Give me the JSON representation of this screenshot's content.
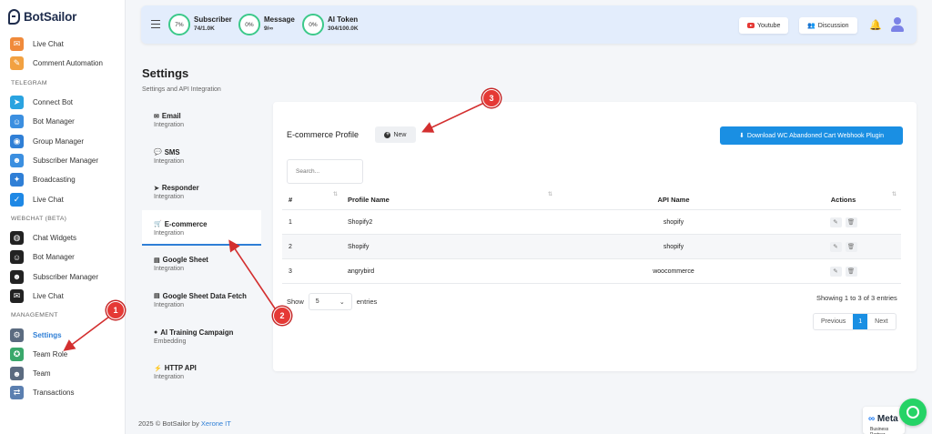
{
  "brand": {
    "name": "BotSailor"
  },
  "sidebar": {
    "items_top": [
      {
        "label": "Live Chat",
        "icon": "chat-bubble-icon",
        "color": "#f08a3b"
      },
      {
        "label": "Comment Automation",
        "icon": "comment-icon",
        "color": "#f2a142"
      }
    ],
    "telegram_heading": "TELEGRAM",
    "telegram": [
      {
        "label": "Connect Bot",
        "icon": "telegram-icon",
        "color": "#2aa3e0"
      },
      {
        "label": "Bot Manager",
        "icon": "robot-icon",
        "color": "#3b8fe0"
      },
      {
        "label": "Group Manager",
        "icon": "group-icon",
        "color": "#2f7fd6"
      },
      {
        "label": "Subscriber Manager",
        "icon": "subscriber-icon",
        "color": "#3b8fe0"
      },
      {
        "label": "Broadcasting",
        "icon": "broadcast-icon",
        "color": "#2f7fd6"
      },
      {
        "label": "Live Chat",
        "icon": "check-bubble-icon",
        "color": "#1e88e5"
      }
    ],
    "webchat_heading": "WEBCHAT (BETA)",
    "webchat": [
      {
        "label": "Chat Widgets",
        "icon": "globe-icon",
        "color": "#222222"
      },
      {
        "label": "Bot Manager",
        "icon": "robot-icon",
        "color": "#222222"
      },
      {
        "label": "Subscriber Manager",
        "icon": "subscriber-icon",
        "color": "#222222"
      },
      {
        "label": "Live Chat",
        "icon": "chat-bubble-icon",
        "color": "#222222"
      }
    ],
    "management_heading": "MANAGEMENT",
    "management": [
      {
        "label": "Settings",
        "icon": "gear-icon",
        "color": "#5b6b80",
        "active": true
      },
      {
        "label": "Team Role",
        "icon": "shield-icon",
        "color": "#3aa86b"
      },
      {
        "label": "Team",
        "icon": "team-icon",
        "color": "#5b6b80"
      },
      {
        "label": "Transactions",
        "icon": "transaction-icon",
        "color": "#5b7fb0"
      }
    ]
  },
  "topbar": {
    "stats": [
      {
        "percent": "7%",
        "title": "Subscriber",
        "value": "74/1.0K"
      },
      {
        "percent": "0%",
        "title": "Message",
        "value": "9/∞"
      },
      {
        "percent": "0%",
        "title": "AI Token",
        "value": "304/100.0K"
      }
    ],
    "youtube_label": "Youtube",
    "discussion_label": "Discussion"
  },
  "page": {
    "title": "Settings",
    "subtitle": "Settings and API Integration"
  },
  "settings_nav": [
    {
      "icon": "✉",
      "title": "Email",
      "sub": "Integration"
    },
    {
      "icon": "💬",
      "title": "SMS",
      "sub": "Integration"
    },
    {
      "icon": "➤",
      "title": "Responder",
      "sub": "Integration"
    },
    {
      "icon": "🛒",
      "title": "E-commerce",
      "sub": "Integration",
      "active": true
    },
    {
      "icon": "▤",
      "title": "Google Sheet",
      "sub": "Integration"
    },
    {
      "icon": "▤",
      "title": "Google Sheet Data Fetch",
      "sub": "Integration"
    },
    {
      "icon": "●",
      "title": "AI Training Campaign",
      "sub": "Embedding"
    },
    {
      "icon": "⚡",
      "title": "HTTP API",
      "sub": "Integration"
    }
  ],
  "card": {
    "title": "E-commerce Profile",
    "new_label": "New",
    "download_label": "Download WC Abandoned Cart Webhook Plugin",
    "search_placeholder": "Search...",
    "columns": [
      "#",
      "Profile Name",
      "API Name",
      "Actions"
    ],
    "rows": [
      {
        "num": "1",
        "profile": "Shopify2",
        "api": "shopify"
      },
      {
        "num": "2",
        "profile": "Shopify",
        "api": "shopify"
      },
      {
        "num": "3",
        "profile": "angrybird",
        "api": "woocommerce"
      }
    ],
    "show_label": "Show",
    "entries_value": "5",
    "entries_label": "entries",
    "showing_text": "Showing 1 to 3 of 3 entries",
    "pager": {
      "previous": "Previous",
      "current": "1",
      "next": "Next"
    }
  },
  "footer": {
    "text": "2025 © BotSailor by ",
    "link": "Xerone IT"
  },
  "markers": [
    "1",
    "2",
    "3"
  ],
  "meta_badge": {
    "logo": "Meta",
    "sub": "Business Partner"
  },
  "colors": {
    "accent": "#1a8fe3",
    "ring": "#3cc98a",
    "marker": "#e53935",
    "topbar": "#e3edfc"
  }
}
